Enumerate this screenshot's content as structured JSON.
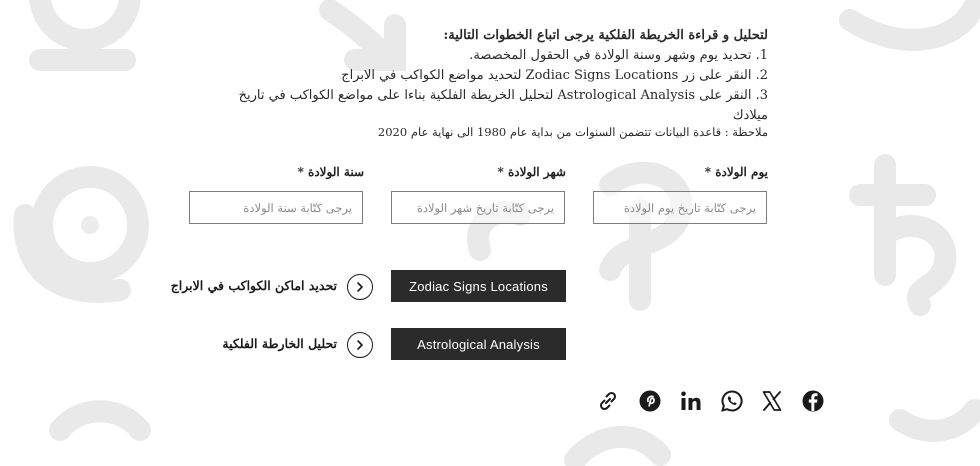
{
  "instructions": {
    "lead": "لتحليل و قراءة الخريطة الفلكية يرجى اتباع الخطوات التالية:",
    "steps": [
      "1. تحديد يوم وشهر وسنة الولادة في الحقول المخصصة.",
      "2. النقر على زر Zodiac Signs Locations لتحديد مواضع الكواكب في الابراج",
      "3. النقر على Astrological Analysis لتحليل الخريطة الفلكية بناءا على مواضع الكواكب في تاريخ ميلادك"
    ],
    "note": "ملاحظة : قاعدة البيانات تتضمن السنوات من بداية عام 1980 الى نهاية عام 2020"
  },
  "form": {
    "day": {
      "label": "يوم الولادة *",
      "placeholder": "يرجى كتّابة تاريخ يوم الولادة",
      "value": ""
    },
    "month": {
      "label": "شهر الولادة *",
      "placeholder": "يرجى كتّابة تاريخ شهر الولادة",
      "value": ""
    },
    "year": {
      "label": "سنة الولادة *",
      "placeholder": "يرجى كتّابة سنة الولادة",
      "value": ""
    }
  },
  "actions": {
    "zodiac": {
      "button": "Zodiac Signs Locations",
      "label": "تحديد اماكن الكواكب في الابراج",
      "icon": "chevron-right-circle-icon"
    },
    "analysis": {
      "button": "Astrological Analysis",
      "label": "تحليل الخارطة الفلكية",
      "icon": "chevron-right-circle-icon"
    }
  },
  "share": {
    "icons": [
      "link-icon",
      "pinterest-icon",
      "linkedin-icon",
      "whatsapp-icon",
      "x-icon",
      "facebook-icon"
    ]
  },
  "colors": {
    "button_bg": "#2b2b2b",
    "button_text": "#ffffff",
    "input_border": "#7d7d7d",
    "background_glyphs": "#e8e8e8"
  }
}
